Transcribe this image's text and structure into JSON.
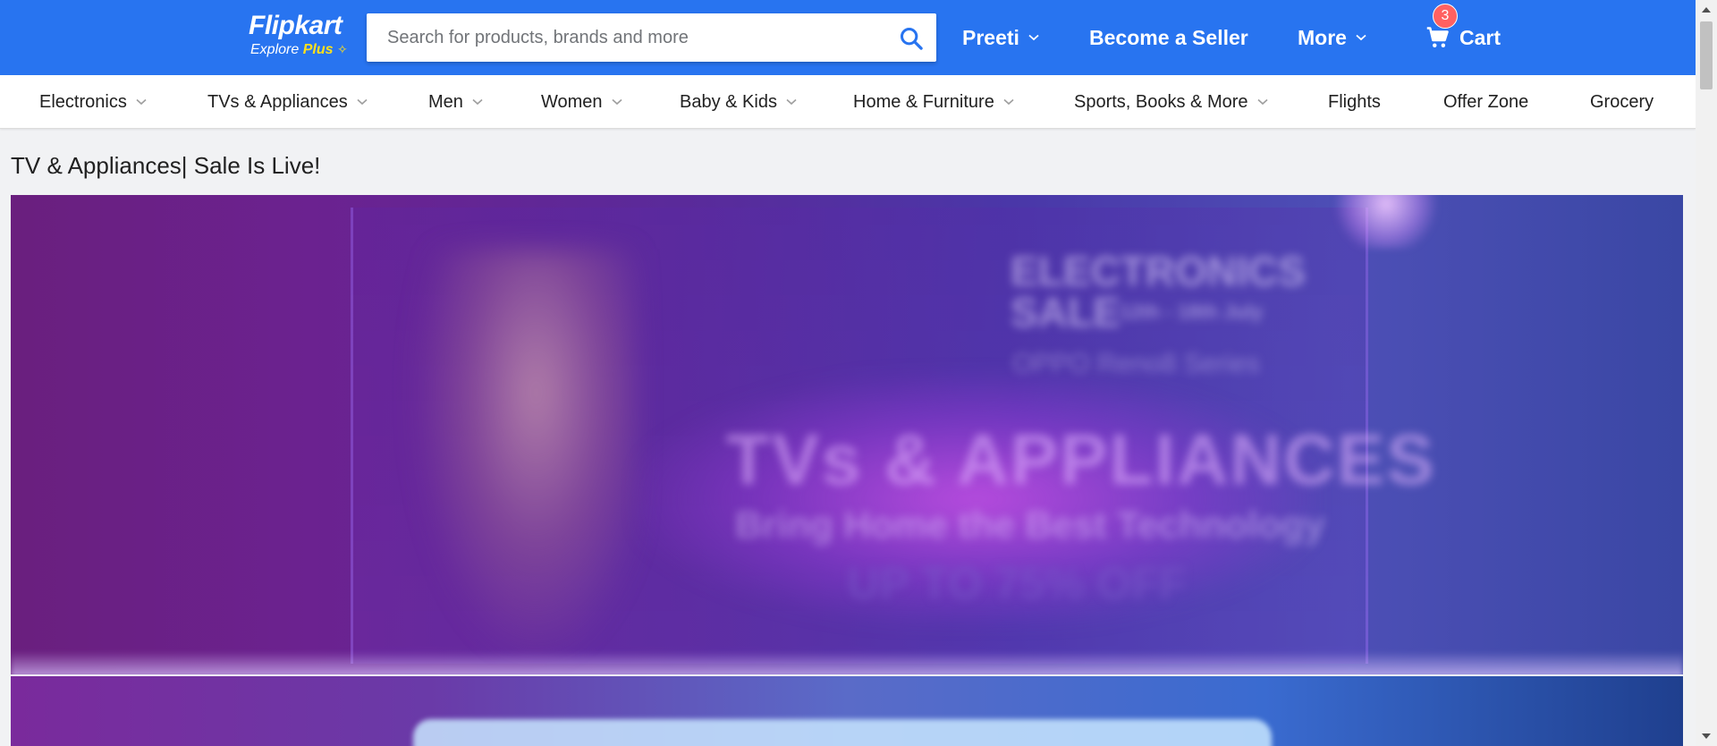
{
  "header": {
    "logo": {
      "name": "Flipkart",
      "tagline_explore": "Explore",
      "tagline_plus": "Plus"
    },
    "search": {
      "placeholder": "Search for products, brands and more",
      "value": ""
    },
    "user_label": "Preeti",
    "seller_label": "Become a Seller",
    "more_label": "More",
    "cart": {
      "label": "Cart",
      "count": "3"
    }
  },
  "categories": [
    {
      "label": "Electronics",
      "has_dropdown": true
    },
    {
      "label": "TVs & Appliances",
      "has_dropdown": true
    },
    {
      "label": "Men",
      "has_dropdown": true
    },
    {
      "label": "Women",
      "has_dropdown": true
    },
    {
      "label": "Baby & Kids",
      "has_dropdown": true
    },
    {
      "label": "Home & Furniture",
      "has_dropdown": true
    },
    {
      "label": "Sports, Books & More",
      "has_dropdown": true
    },
    {
      "label": "Flights",
      "has_dropdown": false
    },
    {
      "label": "Offer Zone",
      "has_dropdown": false
    },
    {
      "label": "Grocery",
      "has_dropdown": false
    }
  ],
  "main": {
    "title": "TV & Appliances| Sale Is Live!",
    "banner": {
      "event": "ELECTRONICS SALE",
      "dates": "12th - 18th July",
      "featured": "OPPO Reno8 Series",
      "headline": "TVs & APPLIANCES",
      "tagline": "Bring Home the Best Technology",
      "offer": "UP TO 75% OFF"
    }
  },
  "colors": {
    "header_bg": "#2874f0",
    "plus_yellow": "#ffe11b",
    "badge_red": "#ff6161",
    "page_bg": "#f1f2f4"
  },
  "icons": {
    "search": "search-icon",
    "cart": "cart-icon",
    "chevron": "chevron-down-icon"
  }
}
